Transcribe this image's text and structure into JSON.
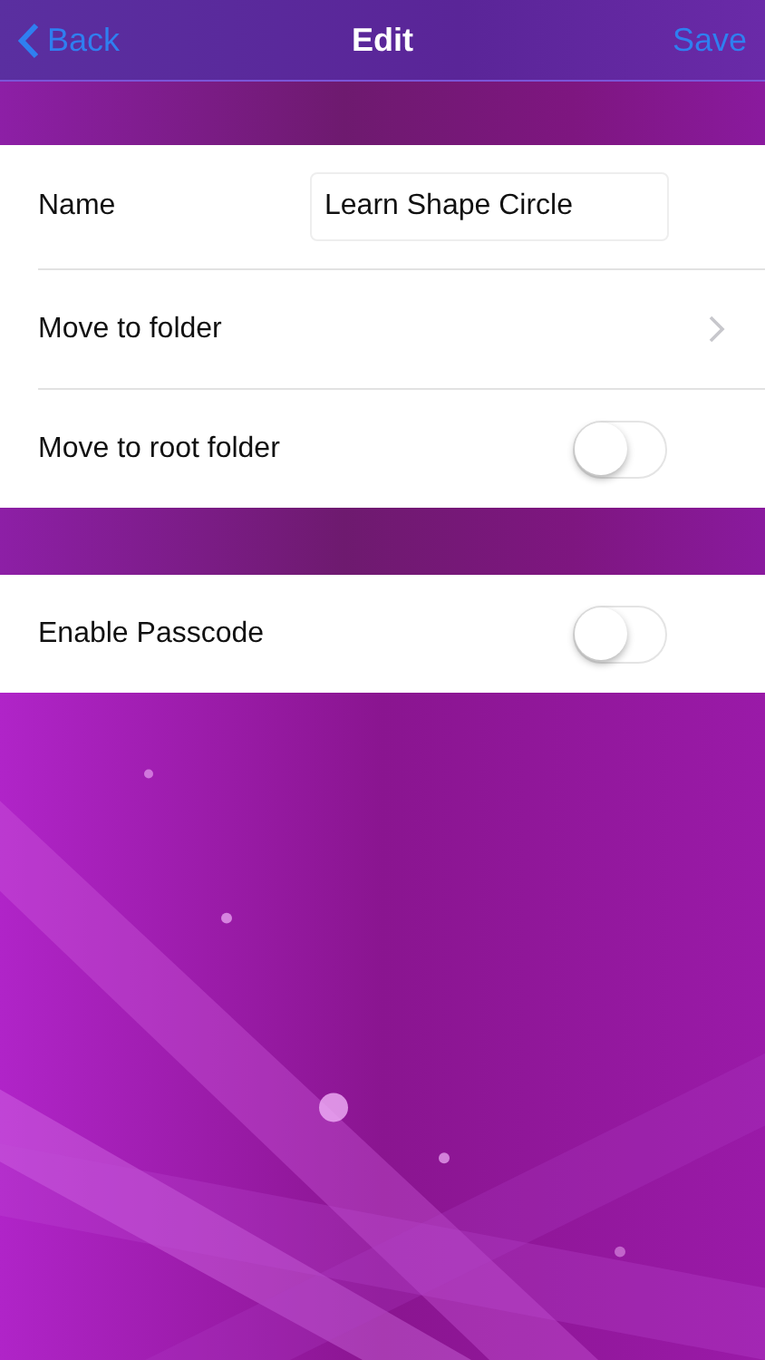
{
  "nav_bar": {
    "back": "Back",
    "title": "Edit",
    "action": "Save"
  },
  "sections": [
    {
      "rows": [
        {
          "kind": "text_field",
          "label": "Name",
          "value": "Learn Shape Circle"
        },
        {
          "kind": "link",
          "label": "Move to folder"
        },
        {
          "kind": "switch",
          "label": "Move to root folder",
          "on": false
        }
      ]
    },
    {
      "rows": [
        {
          "kind": "switch",
          "label": "Enable Passcode",
          "on": false
        }
      ]
    }
  ]
}
